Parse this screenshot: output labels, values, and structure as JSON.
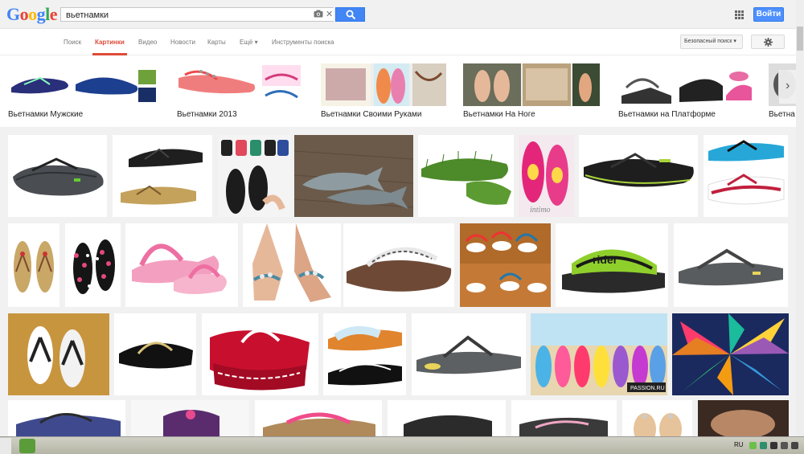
{
  "logo": {
    "letters": [
      "G",
      "o",
      "o",
      "g",
      "l",
      "e"
    ],
    "colors": [
      "#4285f4",
      "#ea4335",
      "#fbbc05",
      "#4285f4",
      "#34a853",
      "#ea4335"
    ]
  },
  "search": {
    "query": "вьетнамки"
  },
  "header": {
    "signin_label": "Войти",
    "icons": [
      "camera-icon",
      "clear-icon",
      "search-icon",
      "apps-icon"
    ]
  },
  "nav": {
    "items": [
      "Поиск",
      "Картинки",
      "Видео",
      "Новости",
      "Карты",
      "Ещё ▾",
      "Инструменты поиска"
    ],
    "active_index": 1,
    "safe_search_label": "Безопасный поиск ▾",
    "settings_icon": "gear-icon"
  },
  "related": {
    "items": [
      {
        "label": "Вьетнамки Мужские"
      },
      {
        "label": "Вьетнамки 2013"
      },
      {
        "label": "Вьетнамки Своими Руками"
      },
      {
        "label": "Вьетнамки На Ноге"
      },
      {
        "label": "Вьетнамки на Платформе"
      },
      {
        "label": "Вьетна"
      }
    ],
    "next_icon": "chevron-right-icon"
  },
  "tiles": {
    "watermarks": {
      "intimo": "intimo",
      "rider": "rider",
      "passion": "PASSION.RU"
    }
  },
  "taskbar": {
    "lang": "RU"
  },
  "colors": {
    "accent": "#dd4b39",
    "button_blue": "#4d90fe",
    "grid_bg": "#f1f1f1"
  }
}
